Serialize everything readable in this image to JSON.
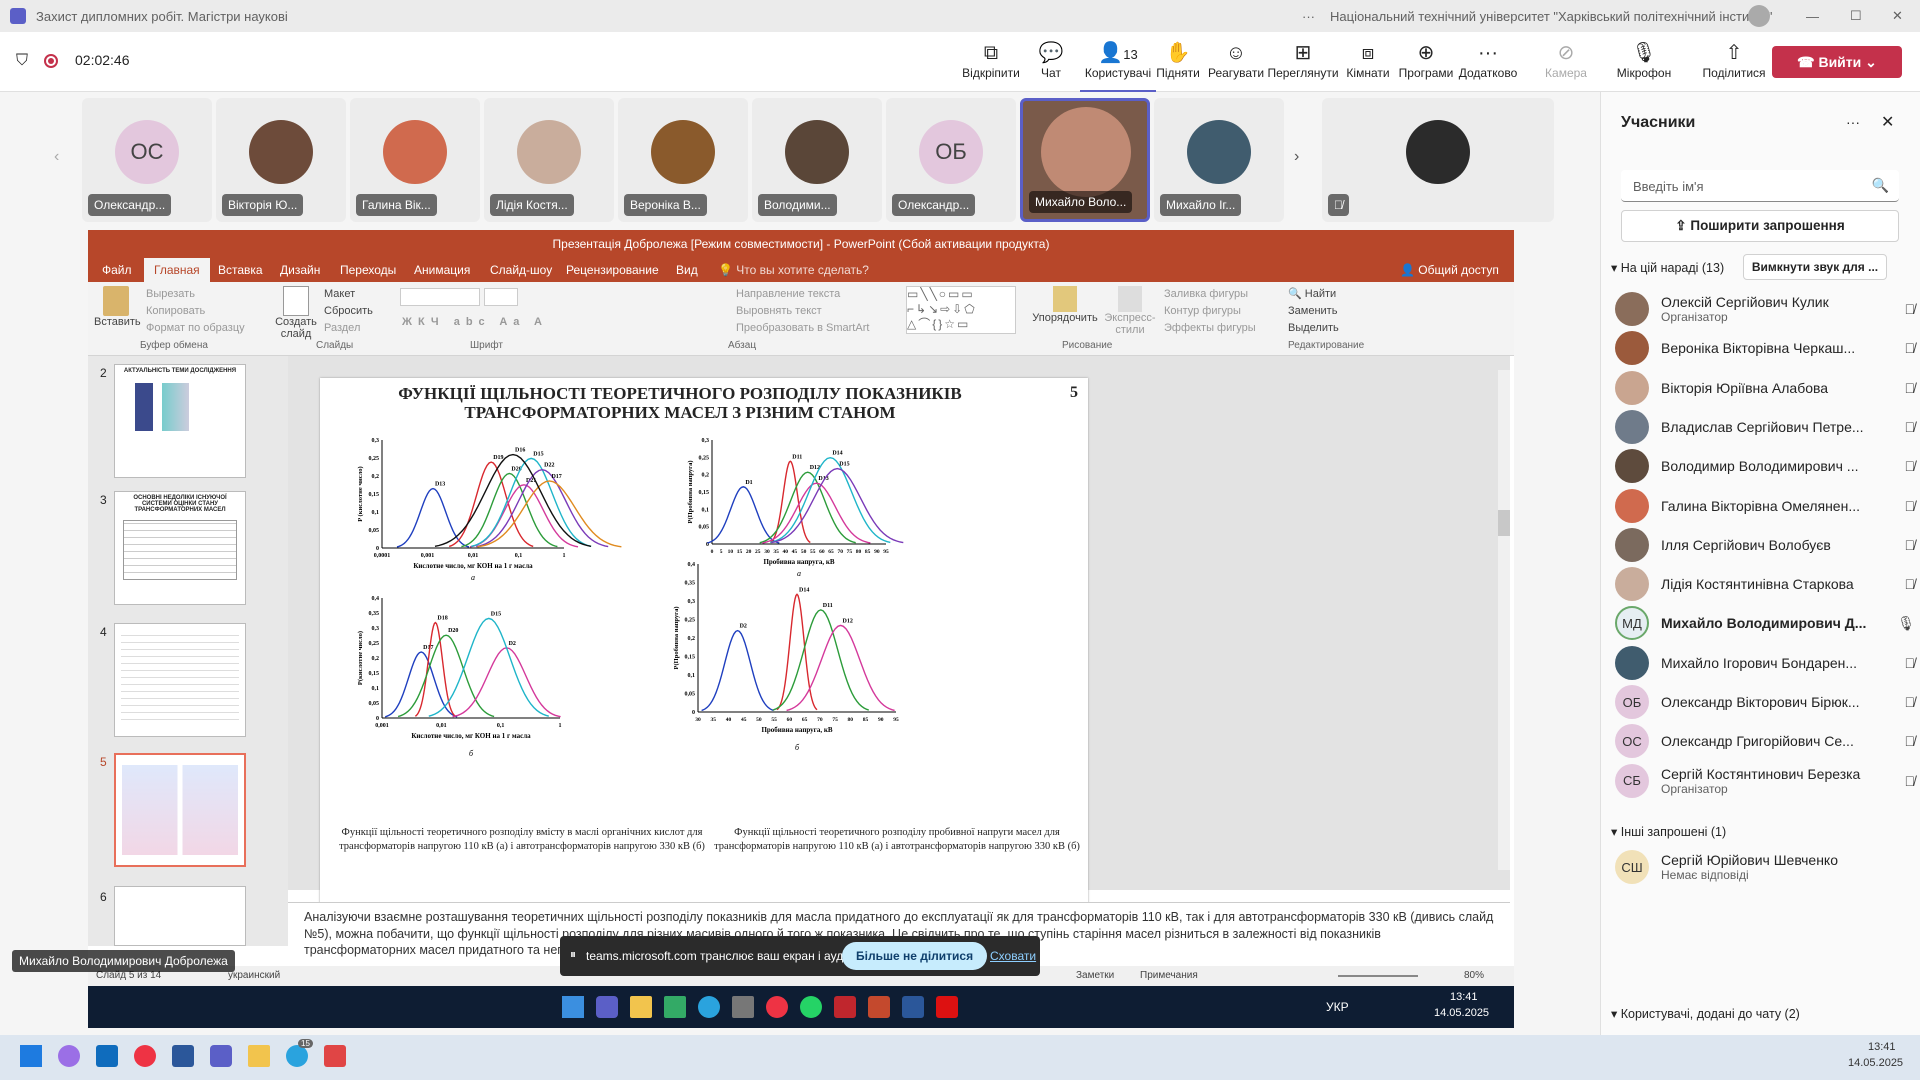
{
  "window": {
    "title": "Захист дипломних робіт. Магістри наукові",
    "org": "Національний технічний університет \"Харківський політехнічний інститут\""
  },
  "meeting": {
    "timer": "02:02:46",
    "participants_count": "13",
    "controls": [
      {
        "icon": "pop-out-icon",
        "label": "Відкріпити"
      },
      {
        "icon": "chat-icon",
        "label": "Чат"
      },
      {
        "icon": "people-icon",
        "label": "Користувачі"
      },
      {
        "icon": "raise-hand-icon",
        "label": "Підняти"
      },
      {
        "icon": "react-icon",
        "label": "Реагувати"
      },
      {
        "icon": "view-icon",
        "label": "Переглянути"
      },
      {
        "icon": "rooms-icon",
        "label": "Кімнати"
      },
      {
        "icon": "apps-icon",
        "label": "Програми"
      },
      {
        "icon": "more-icon",
        "label": "Додатково"
      }
    ],
    "media": [
      {
        "icon": "camera-off-icon",
        "label": "Камера"
      },
      {
        "icon": "mic-off-icon",
        "label": "Мікрофон"
      },
      {
        "icon": "share-icon",
        "label": "Поділитися"
      }
    ],
    "leave_label": "Вийти"
  },
  "video_tiles": [
    {
      "name": "Олександр...",
      "initials": "ОС"
    },
    {
      "name": "Вікторія Ю...",
      "initials": ""
    },
    {
      "name": "Галина Вік...",
      "initials": ""
    },
    {
      "name": "Лідія Костя...",
      "initials": ""
    },
    {
      "name": "Вероніка В...",
      "initials": ""
    },
    {
      "name": "Володими...",
      "initials": ""
    },
    {
      "name": "Олександр...",
      "initials": "ОБ"
    },
    {
      "name": "Михайло Воло...",
      "initials": ""
    },
    {
      "name": "Михайло Іг...",
      "initials": ""
    },
    {
      "name": "",
      "initials": ""
    }
  ],
  "presenter_label": "Михайло Володимирович Добролежа",
  "participants_panel": {
    "title": "Учасники",
    "search_placeholder": "Введіть ім'я",
    "invite_label": "Поширити запрошення",
    "section_meeting": "На цій нараді (13)",
    "mute_all": "Вимкнути звук для ...",
    "people": [
      {
        "name": "Олексій Сергійович Кулик",
        "role": "Організатор",
        "initials": ""
      },
      {
        "name": "Вероніка Вікторівна Черкаш...",
        "role": "",
        "initials": ""
      },
      {
        "name": "Вікторія Юріївна Алабова",
        "role": "",
        "initials": ""
      },
      {
        "name": "Владислав Сергійович Петре...",
        "role": "",
        "initials": ""
      },
      {
        "name": "Володимир Володимирович ...",
        "role": "",
        "initials": ""
      },
      {
        "name": "Галина Вікторівна Омелянен...",
        "role": "",
        "initials": ""
      },
      {
        "name": "Ілля Сергійович Волобуєв",
        "role": "",
        "initials": ""
      },
      {
        "name": "Лідія Костянтинівна Старкова",
        "role": "",
        "initials": ""
      },
      {
        "name": "Михайло Володимирович Д...",
        "role": "",
        "initials": "МД"
      },
      {
        "name": "Михайло Ігорович Бондарен...",
        "role": "",
        "initials": ""
      },
      {
        "name": "Олександр Вікторович Бірюк...",
        "role": "",
        "initials": "ОБ"
      },
      {
        "name": "Олександр Григорійович Се...",
        "role": "",
        "initials": "ОС"
      },
      {
        "name": "Сергій Костянтинович Березка",
        "role": "Організатор",
        "initials": "СБ"
      }
    ],
    "section_others": "Інші запрошені (1)",
    "other": {
      "name": "Сергій Юрійович Шевченко",
      "role": "Немає відповіді",
      "initials": "СШ"
    },
    "section_chat": "Користувачі, додані до чату (2)"
  },
  "ppt": {
    "title": "Презентація Добролежа [Режим совместимости] - PowerPoint (Сбой активации продукта)",
    "tabs": [
      "Файл",
      "Главная",
      "Вставка",
      "Дизайн",
      "Переходы",
      "Анимация",
      "Слайд-шоу",
      "Рецензирование",
      "Вид",
      "Что вы хотите сделать?"
    ],
    "share_label": "Общий доступ",
    "groups": [
      "Буфер обмена",
      "Слайды",
      "Шрифт",
      "Абзац",
      "Рисование",
      "Редактирование"
    ],
    "ribbon_items": [
      "Вставить",
      "Вырезать",
      "Копировать",
      "Формат по образцу",
      "Создать слайд",
      "Макет",
      "Сбросить",
      "Раздел",
      "Направление текста",
      "Выровнять текст",
      "Преобразовать в SmartArt",
      "Упорядочить",
      "Экспресс-стили",
      "Заливка фигуры",
      "Контур фигуры",
      "Эффекты фигуры",
      "Найти",
      "Заменить",
      "Выделить"
    ],
    "thumb_numbers": [
      "2",
      "3",
      "4",
      "5",
      "6"
    ],
    "thumb_titles": [
      "АКТУАЛЬНІСТЬ ТЕМИ ДОСЛІДЖЕННЯ",
      "ОСНОВНІ НЕДОЛІКИ ІСНУЮЧОЇ СИСТЕМИ ОЦІНКИ СТАНУ ТРАНСФОРМАТОРНИХ МАСЕЛ"
    ],
    "slide": {
      "title": "ФУНКЦІЇ ЩІЛЬНОСТІ ТЕОРЕТИЧНОГО РОЗПОДІЛУ ПОКАЗНИКІВ ТРАНСФОРМАТОРНИХ МАСЕЛ З РІЗНИМ СТАНОМ",
      "number": "5",
      "caption_left": "Функції щільності теоретичного розподілу вмісту в маслі органічних кислот для трансформаторів напругою 110 кВ (а) і автотрансформаторів напругою 330 кВ (б)",
      "caption_right": "Функції щільності теоретичного розподілу пробивної напруги масел для трансформаторів напругою 110 кВ (а) і автотрансформаторів напругою 330 кВ (б)",
      "chart_data": [
        {
          "type": "line",
          "panel": "а",
          "xlabel": "Кислотне число, мг КОН на 1 г масла",
          "ylabel": "P (кислотне число)",
          "x_ticks": [
            "0,0001",
            "0,001",
            "0,01",
            "0,1",
            "1"
          ],
          "y_ticks": [
            "0",
            "0,05",
            "0,1",
            "0,15",
            "0,2",
            "0,25",
            "0,3"
          ],
          "ylim": [
            0,
            0.3
          ],
          "labels": [
            "D13",
            "D19",
            "D20",
            "D21",
            "D15",
            "D22",
            "D17",
            "D16"
          ]
        },
        {
          "type": "line",
          "panel": "а",
          "xlabel": "Пробивна напруга, кВ",
          "ylabel": "P(Пробивна напруга)",
          "x_ticks": [
            "0",
            "5",
            "10",
            "15",
            "20",
            "25",
            "30",
            "35",
            "40",
            "45",
            "50",
            "55",
            "60",
            "65",
            "70",
            "75",
            "80",
            "85",
            "90",
            "95"
          ],
          "y_ticks": [
            "0",
            "0,05",
            "0,1",
            "0,15",
            "0,2",
            "0,25",
            "0,3"
          ],
          "ylim": [
            0,
            0.3
          ],
          "labels": [
            "D1",
            "D11",
            "D12",
            "D13",
            "D14",
            "D15"
          ]
        },
        {
          "type": "line",
          "panel": "б",
          "xlabel": "Кислотне число, мг КОН на 1 г масла",
          "ylabel": "P(кислотне число)",
          "x_ticks": [
            "0,001",
            "0,01",
            "0,1",
            "1"
          ],
          "y_ticks": [
            "0",
            "0,05",
            "0,1",
            "0,15",
            "0,2",
            "0,25",
            "0,3",
            "0,35",
            "0,4"
          ],
          "ylim": [
            0,
            0.4
          ],
          "labels": [
            "D17",
            "D18",
            "D20",
            "D2",
            "D15"
          ]
        },
        {
          "type": "line",
          "panel": "б",
          "xlabel": "Пробивна напруга, кВ",
          "ylabel": "P(Пробивна напруга)",
          "x_ticks": [
            "30",
            "35",
            "40",
            "45",
            "50",
            "55",
            "60",
            "65",
            "70",
            "75",
            "80",
            "85",
            "90",
            "95"
          ],
          "y_ticks": [
            "0",
            "0,05",
            "0,1",
            "0,15",
            "0,2",
            "0,25",
            "0,3",
            "0,35",
            "0,4"
          ],
          "ylim": [
            0,
            0.4
          ],
          "labels": [
            "D2",
            "D14",
            "D11",
            "D12"
          ]
        }
      ]
    },
    "notes": "Аналізуючи взаємне розташування теоретичних щільності розподілу показників для масла придатного до експлуатації як для трансформаторів 110 кВ, так і для автотрансформаторів 330 кВ (дивись слайд №5), можна побачити, що функції щільності розподілу для різних масивів одного й того ж показника. Це свідчить про те, що ступінь старіння масел різниться в залежності від показників трансформаторних масел придатного та непридатного до експлуатації станів.",
    "status_slide": "Слайд 5 из 14",
    "status_lang": "украинский",
    "status_notes": "Заметки",
    "status_comments": "Примечания",
    "zoom": "80%",
    "taskbar_lang": "УКР",
    "taskbar_time": "13:41",
    "taskbar_date": "14.05.2025"
  },
  "share_banner": {
    "text": "teams.microsoft.com транслює ваш екран і аудіо.",
    "stop": "Більше не ділитися",
    "hide": "Сховати"
  },
  "os": {
    "time": "13:41",
    "date": "14.05.2025",
    "telegram_badge": "15"
  },
  "colors": {
    "teams_leave": "#c4314b",
    "ppt_red": "#b7472a",
    "accent": "#5b5fc7"
  }
}
